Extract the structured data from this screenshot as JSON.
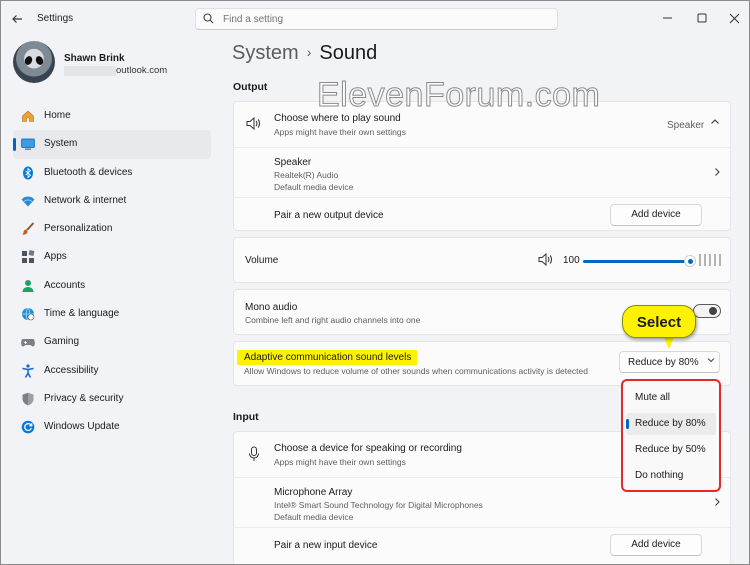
{
  "window": {
    "app_title": "Settings",
    "back_icon": "back-arrow-icon",
    "controls": [
      "minimize-icon",
      "maximize-icon",
      "close-icon"
    ]
  },
  "search": {
    "placeholder": "Find a setting",
    "value": ""
  },
  "profile": {
    "name": "Shawn Brink",
    "email_visible": "outlook.com"
  },
  "sidebar": {
    "items": [
      {
        "label": "Home",
        "icon": "home-icon",
        "color": "#e8a23a"
      },
      {
        "label": "System",
        "icon": "monitor-icon",
        "color": "#0078d4",
        "active": true
      },
      {
        "label": "Bluetooth & devices",
        "icon": "bluetooth-icon",
        "color": "#0078d4"
      },
      {
        "label": "Network & internet",
        "icon": "wifi-icon",
        "color": "#2b88d8"
      },
      {
        "label": "Personalization",
        "icon": "brush-icon",
        "color": "#c05a28"
      },
      {
        "label": "Apps",
        "icon": "apps-icon",
        "color": "#4a5560"
      },
      {
        "label": "Accounts",
        "icon": "person-icon",
        "color": "#1ea362"
      },
      {
        "label": "Time & language",
        "icon": "globe-clock-icon",
        "color": "#1f8fd6"
      },
      {
        "label": "Gaming",
        "icon": "gamepad-icon",
        "color": "#6b6b6b"
      },
      {
        "label": "Accessibility",
        "icon": "accessibility-icon",
        "color": "#1569c7"
      },
      {
        "label": "Privacy & security",
        "icon": "shield-icon",
        "color": "#6e7378"
      },
      {
        "label": "Windows Update",
        "icon": "update-icon",
        "color": "#0a78d7"
      }
    ]
  },
  "breadcrumb": {
    "parent": "System",
    "separator": "›",
    "current": "Sound"
  },
  "watermark": "ElevenForum.com",
  "output": {
    "section_title": "Output",
    "choose": {
      "title": "Choose where to play sound",
      "subtitle": "Apps might have their own settings",
      "value": "Speaker"
    },
    "device": {
      "name": "Speaker",
      "line1": "Realtek(R) Audio",
      "line2": "Default media device"
    },
    "pair": {
      "label": "Pair a new output device",
      "button": "Add device"
    }
  },
  "volume": {
    "label": "Volume",
    "value": "100",
    "level": 1.0
  },
  "mono": {
    "title": "Mono audio",
    "subtitle": "Combine left and right audio channels into one",
    "on": false
  },
  "adaptive": {
    "title": "Adaptive communication sound levels",
    "subtitle": "Allow Windows to reduce volume of other sounds when communications activity is detected",
    "selected": "Reduce by 80%",
    "options": [
      "Mute all",
      "Reduce by 80%",
      "Reduce by 50%",
      "Do nothing"
    ]
  },
  "callout": {
    "label": "Select"
  },
  "input": {
    "section_title": "Input",
    "choose": {
      "title": "Choose a device for speaking or recording",
      "subtitle": "Apps might have their own settings"
    },
    "device": {
      "name": "Microphone Array",
      "line1": "Intel® Smart Sound Technology for Digital Microphones",
      "line2": "Default media device"
    },
    "pair": {
      "label": "Pair a new input device",
      "button": "Add device"
    }
  },
  "colors": {
    "accent": "#0067c0",
    "highlight": "#fff200",
    "annotation_red": "#e22a2a"
  }
}
